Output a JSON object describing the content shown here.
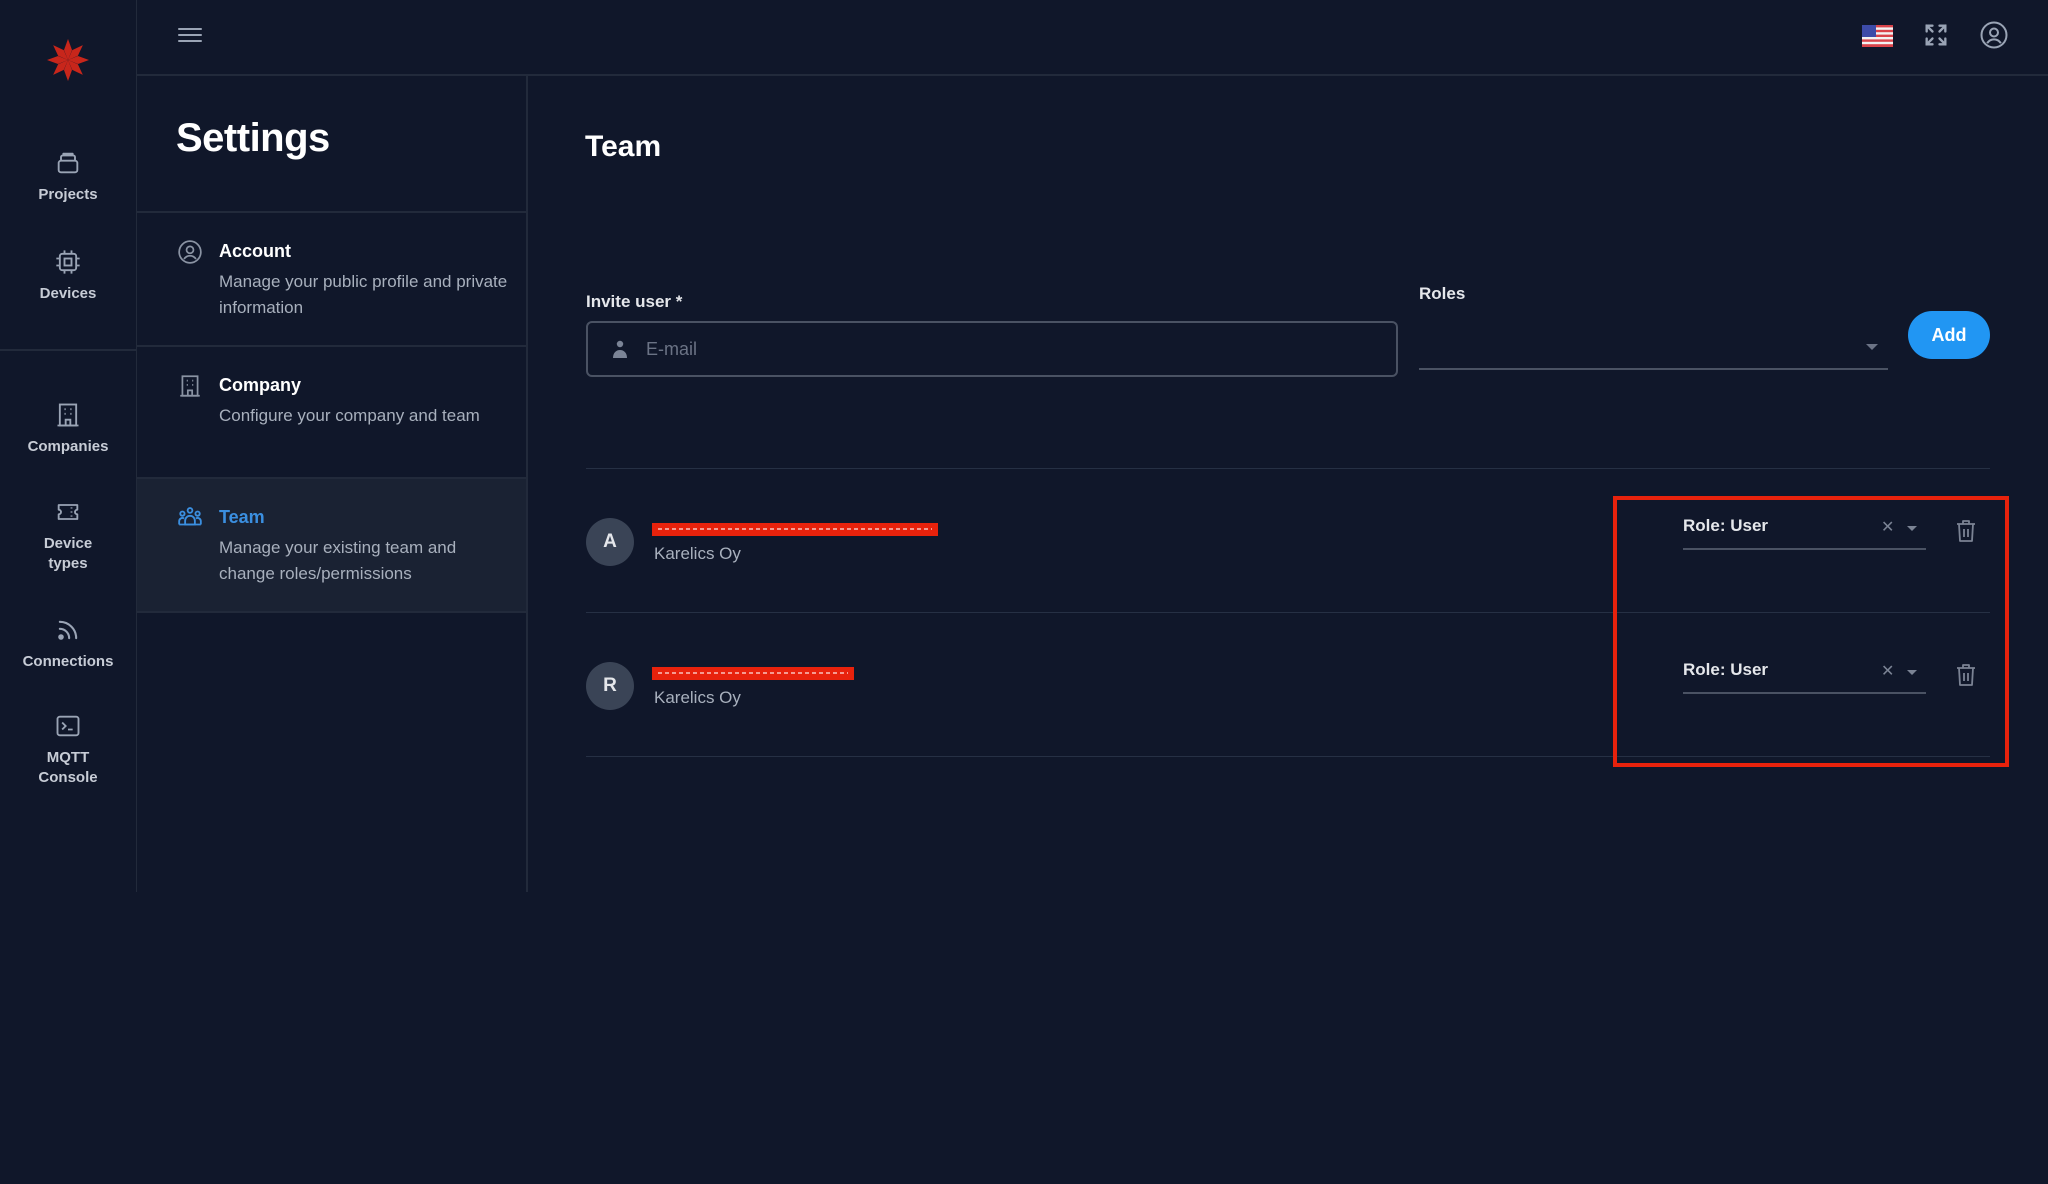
{
  "rail": {
    "logo": "karelics-star-logo",
    "items": [
      {
        "label": "Projects",
        "icon": "projects-icon"
      },
      {
        "label": "Devices",
        "icon": "chip-icon"
      },
      {
        "label": "Companies",
        "icon": "building-icon"
      },
      {
        "label": "Device\ntypes",
        "icon": "ticket-icon"
      },
      {
        "label": "Connections",
        "icon": "wifi-signal-icon"
      },
      {
        "label": "MQTT\nConsole",
        "icon": "terminal-icon"
      }
    ]
  },
  "header": {
    "menu_icon": "hamburger-icon",
    "language": "en-US",
    "fullscreen_icon": "fullscreen-icon",
    "account_icon": "account-circle-icon"
  },
  "settings": {
    "title": "Settings",
    "items": [
      {
        "title": "Account",
        "description": "Manage your public profile and private information",
        "icon": "account-circle-icon",
        "active": false
      },
      {
        "title": "Company",
        "description": "Configure your company and team",
        "icon": "building-icon",
        "active": false
      },
      {
        "title": "Team",
        "description": "Manage your existing team and change roles/permissions",
        "icon": "team-icon",
        "active": true
      }
    ]
  },
  "main": {
    "title": "Team",
    "invite": {
      "label": "Invite user *",
      "placeholder": "E-mail",
      "value": ""
    },
    "roles": {
      "label": "Roles",
      "value": ""
    },
    "add_label": "Add",
    "members": [
      {
        "initial": "A",
        "email": "[redacted]",
        "company": "Karelics Oy",
        "role": "Role: User"
      },
      {
        "initial": "R",
        "email": "[redacted]",
        "company": "Karelics Oy",
        "role": "Role: User"
      }
    ],
    "clear_symbol": "✕",
    "annotation_color": "#e8220c",
    "accent_color": "#2196f3"
  }
}
